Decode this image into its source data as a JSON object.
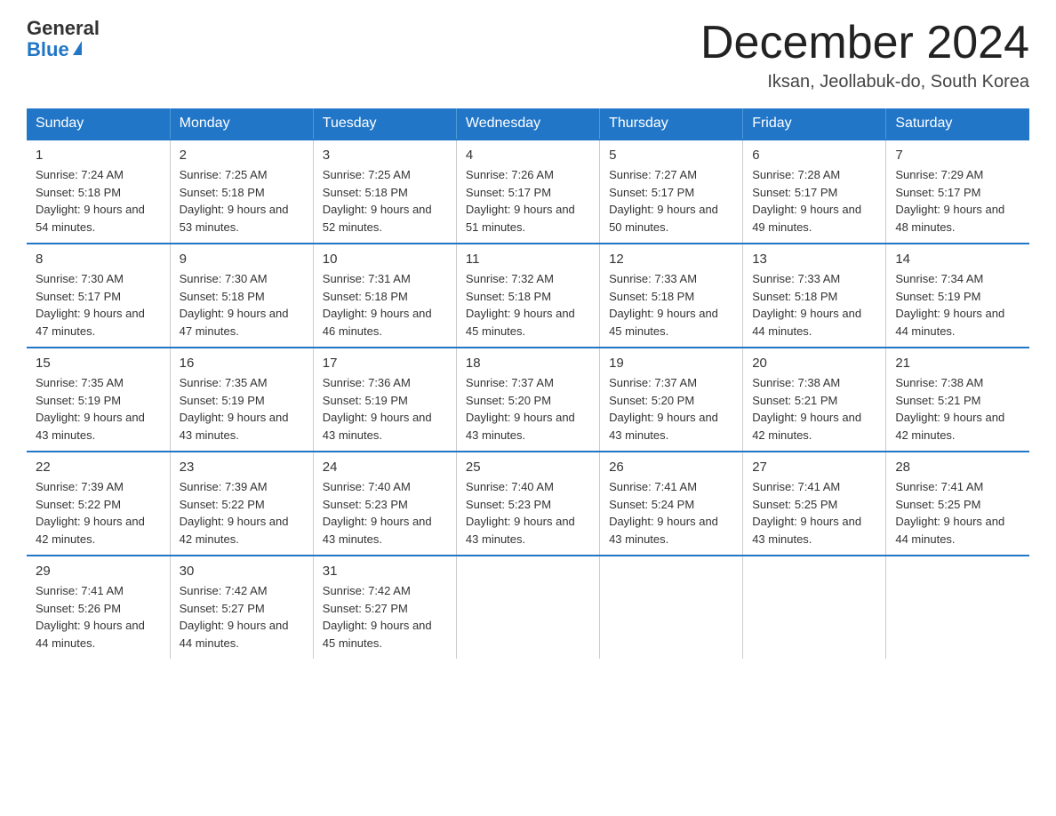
{
  "header": {
    "logo_general": "General",
    "logo_blue": "Blue",
    "month_title": "December 2024",
    "location": "Iksan, Jeollabuk-do, South Korea"
  },
  "weekdays": [
    "Sunday",
    "Monday",
    "Tuesday",
    "Wednesday",
    "Thursday",
    "Friday",
    "Saturday"
  ],
  "weeks": [
    [
      {
        "day": "1",
        "sunrise": "7:24 AM",
        "sunset": "5:18 PM",
        "daylight": "9 hours and 54 minutes."
      },
      {
        "day": "2",
        "sunrise": "7:25 AM",
        "sunset": "5:18 PM",
        "daylight": "9 hours and 53 minutes."
      },
      {
        "day": "3",
        "sunrise": "7:25 AM",
        "sunset": "5:18 PM",
        "daylight": "9 hours and 52 minutes."
      },
      {
        "day": "4",
        "sunrise": "7:26 AM",
        "sunset": "5:17 PM",
        "daylight": "9 hours and 51 minutes."
      },
      {
        "day": "5",
        "sunrise": "7:27 AM",
        "sunset": "5:17 PM",
        "daylight": "9 hours and 50 minutes."
      },
      {
        "day": "6",
        "sunrise": "7:28 AM",
        "sunset": "5:17 PM",
        "daylight": "9 hours and 49 minutes."
      },
      {
        "day": "7",
        "sunrise": "7:29 AM",
        "sunset": "5:17 PM",
        "daylight": "9 hours and 48 minutes."
      }
    ],
    [
      {
        "day": "8",
        "sunrise": "7:30 AM",
        "sunset": "5:17 PM",
        "daylight": "9 hours and 47 minutes."
      },
      {
        "day": "9",
        "sunrise": "7:30 AM",
        "sunset": "5:18 PM",
        "daylight": "9 hours and 47 minutes."
      },
      {
        "day": "10",
        "sunrise": "7:31 AM",
        "sunset": "5:18 PM",
        "daylight": "9 hours and 46 minutes."
      },
      {
        "day": "11",
        "sunrise": "7:32 AM",
        "sunset": "5:18 PM",
        "daylight": "9 hours and 45 minutes."
      },
      {
        "day": "12",
        "sunrise": "7:33 AM",
        "sunset": "5:18 PM",
        "daylight": "9 hours and 45 minutes."
      },
      {
        "day": "13",
        "sunrise": "7:33 AM",
        "sunset": "5:18 PM",
        "daylight": "9 hours and 44 minutes."
      },
      {
        "day": "14",
        "sunrise": "7:34 AM",
        "sunset": "5:19 PM",
        "daylight": "9 hours and 44 minutes."
      }
    ],
    [
      {
        "day": "15",
        "sunrise": "7:35 AM",
        "sunset": "5:19 PM",
        "daylight": "9 hours and 43 minutes."
      },
      {
        "day": "16",
        "sunrise": "7:35 AM",
        "sunset": "5:19 PM",
        "daylight": "9 hours and 43 minutes."
      },
      {
        "day": "17",
        "sunrise": "7:36 AM",
        "sunset": "5:19 PM",
        "daylight": "9 hours and 43 minutes."
      },
      {
        "day": "18",
        "sunrise": "7:37 AM",
        "sunset": "5:20 PM",
        "daylight": "9 hours and 43 minutes."
      },
      {
        "day": "19",
        "sunrise": "7:37 AM",
        "sunset": "5:20 PM",
        "daylight": "9 hours and 43 minutes."
      },
      {
        "day": "20",
        "sunrise": "7:38 AM",
        "sunset": "5:21 PM",
        "daylight": "9 hours and 42 minutes."
      },
      {
        "day": "21",
        "sunrise": "7:38 AM",
        "sunset": "5:21 PM",
        "daylight": "9 hours and 42 minutes."
      }
    ],
    [
      {
        "day": "22",
        "sunrise": "7:39 AM",
        "sunset": "5:22 PM",
        "daylight": "9 hours and 42 minutes."
      },
      {
        "day": "23",
        "sunrise": "7:39 AM",
        "sunset": "5:22 PM",
        "daylight": "9 hours and 42 minutes."
      },
      {
        "day": "24",
        "sunrise": "7:40 AM",
        "sunset": "5:23 PM",
        "daylight": "9 hours and 43 minutes."
      },
      {
        "day": "25",
        "sunrise": "7:40 AM",
        "sunset": "5:23 PM",
        "daylight": "9 hours and 43 minutes."
      },
      {
        "day": "26",
        "sunrise": "7:41 AM",
        "sunset": "5:24 PM",
        "daylight": "9 hours and 43 minutes."
      },
      {
        "day": "27",
        "sunrise": "7:41 AM",
        "sunset": "5:25 PM",
        "daylight": "9 hours and 43 minutes."
      },
      {
        "day": "28",
        "sunrise": "7:41 AM",
        "sunset": "5:25 PM",
        "daylight": "9 hours and 44 minutes."
      }
    ],
    [
      {
        "day": "29",
        "sunrise": "7:41 AM",
        "sunset": "5:26 PM",
        "daylight": "9 hours and 44 minutes."
      },
      {
        "day": "30",
        "sunrise": "7:42 AM",
        "sunset": "5:27 PM",
        "daylight": "9 hours and 44 minutes."
      },
      {
        "day": "31",
        "sunrise": "7:42 AM",
        "sunset": "5:27 PM",
        "daylight": "9 hours and 45 minutes."
      },
      null,
      null,
      null,
      null
    ]
  ]
}
